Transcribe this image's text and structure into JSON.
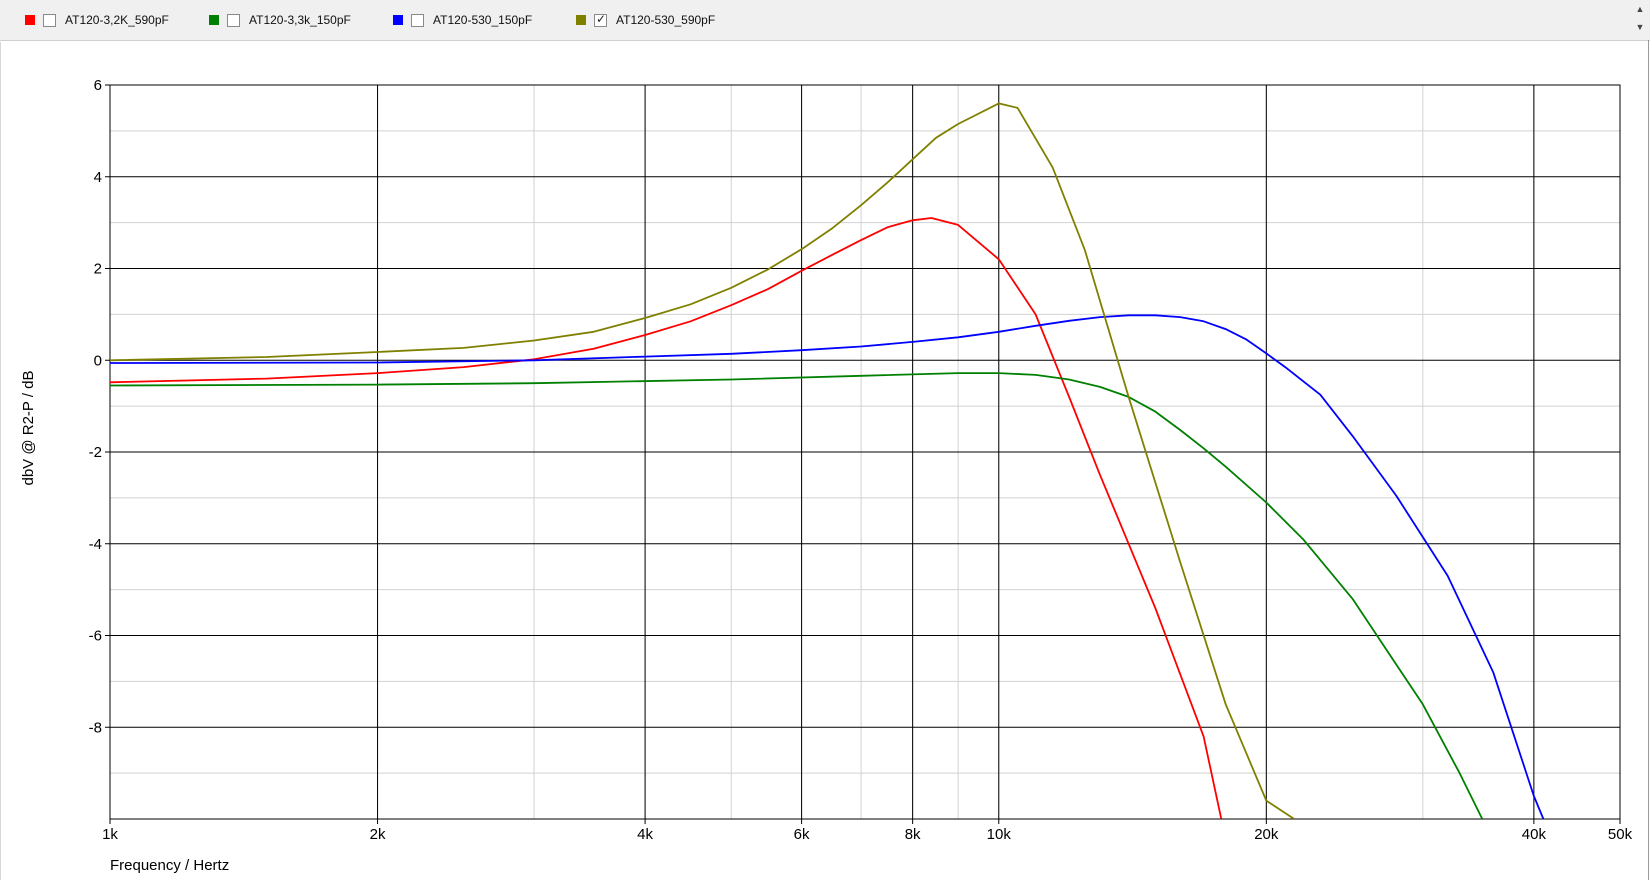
{
  "legend": [
    {
      "label": "AT120-3,2K_590pF",
      "color": "#ff0000",
      "checked": false
    },
    {
      "label": "AT120-3,3k_150pF",
      "color": "#008000",
      "checked": false
    },
    {
      "label": "AT120-530_150pF",
      "color": "#0000ff",
      "checked": false
    },
    {
      "label": "AT120-530_590pF",
      "color": "#808000",
      "checked": true
    }
  ],
  "chart_data": {
    "type": "line",
    "xlabel": "Frequency / Hertz",
    "ylabel": "dbV @ R2-P / dB",
    "xscale": "log",
    "xlim": [
      1000,
      50000
    ],
    "ylim": [
      -10,
      6
    ],
    "grid": true,
    "x_ticks": [
      {
        "v": 1000,
        "label": "1k"
      },
      {
        "v": 2000,
        "label": "2k"
      },
      {
        "v": 4000,
        "label": "4k"
      },
      {
        "v": 6000,
        "label": "6k"
      },
      {
        "v": 8000,
        "label": "8k"
      },
      {
        "v": 10000,
        "label": "10k"
      },
      {
        "v": 20000,
        "label": "20k"
      },
      {
        "v": 40000,
        "label": "40k"
      },
      {
        "v": 50000,
        "label": "50k"
      }
    ],
    "y_ticks": [
      {
        "v": 6,
        "label": "6"
      },
      {
        "v": 4,
        "label": "4"
      },
      {
        "v": 2,
        "label": "2"
      },
      {
        "v": 0,
        "label": "0"
      },
      {
        "v": -2,
        "label": "-2"
      },
      {
        "v": -4,
        "label": "-4"
      },
      {
        "v": -6,
        "label": "-6"
      },
      {
        "v": -8,
        "label": "-8"
      }
    ],
    "series": [
      {
        "name": "AT120-3,2K_590pF",
        "color": "#ff0000",
        "x": [
          1000,
          1500,
          2000,
          2500,
          3000,
          3500,
          4000,
          4500,
          5000,
          5500,
          6000,
          6500,
          7000,
          7500,
          8000,
          8400,
          9000,
          10000,
          11000,
          12000,
          13000,
          15000,
          17000,
          17800
        ],
        "y": [
          -0.48,
          -0.4,
          -0.28,
          -0.15,
          0.02,
          0.25,
          0.55,
          0.85,
          1.2,
          1.55,
          1.95,
          2.3,
          2.62,
          2.9,
          3.05,
          3.1,
          2.95,
          2.2,
          1.0,
          -0.8,
          -2.5,
          -5.4,
          -8.2,
          -10
        ]
      },
      {
        "name": "AT120-3,3k_150pF",
        "color": "#008000",
        "x": [
          1000,
          2000,
          3000,
          5000,
          7000,
          9000,
          10000,
          11000,
          12000,
          13000,
          14000,
          15000,
          16000,
          17000,
          18000,
          20000,
          22000,
          25000,
          30000,
          33000,
          35000
        ],
        "y": [
          -0.55,
          -0.53,
          -0.5,
          -0.42,
          -0.34,
          -0.28,
          -0.28,
          -0.32,
          -0.42,
          -0.58,
          -0.8,
          -1.12,
          -1.52,
          -1.92,
          -2.32,
          -3.1,
          -3.9,
          -5.2,
          -7.5,
          -9.0,
          -10
        ]
      },
      {
        "name": "AT120-530_150pF",
        "color": "#0000ff",
        "x": [
          1000,
          2000,
          3000,
          4000,
          5000,
          6000,
          7000,
          8000,
          9000,
          10000,
          11000,
          12000,
          13000,
          14000,
          15000,
          16000,
          17000,
          18000,
          19000,
          20000,
          21000,
          23000,
          25000,
          28000,
          32000,
          36000,
          40000,
          41000
        ],
        "y": [
          -0.06,
          -0.05,
          0.0,
          0.08,
          0.14,
          0.22,
          0.3,
          0.4,
          0.5,
          0.62,
          0.75,
          0.86,
          0.94,
          0.98,
          0.98,
          0.94,
          0.85,
          0.68,
          0.45,
          0.15,
          -0.15,
          -0.75,
          -1.65,
          -2.95,
          -4.7,
          -6.8,
          -9.5,
          -10
        ]
      },
      {
        "name": "AT120-530_590pF",
        "color": "#808000",
        "x": [
          1000,
          1500,
          2000,
          2500,
          3000,
          3500,
          4000,
          4500,
          5000,
          5500,
          6000,
          6500,
          7000,
          7500,
          8000,
          8500,
          9000,
          10000,
          10500,
          11500,
          12500,
          14000,
          16000,
          18000,
          20000,
          21500
        ],
        "y": [
          0.0,
          0.07,
          0.18,
          0.27,
          0.43,
          0.62,
          0.92,
          1.22,
          1.58,
          1.98,
          2.42,
          2.88,
          3.38,
          3.88,
          4.38,
          4.85,
          5.15,
          5.6,
          5.5,
          4.2,
          2.4,
          -0.8,
          -4.4,
          -7.5,
          -9.6,
          -10
        ]
      }
    ]
  }
}
